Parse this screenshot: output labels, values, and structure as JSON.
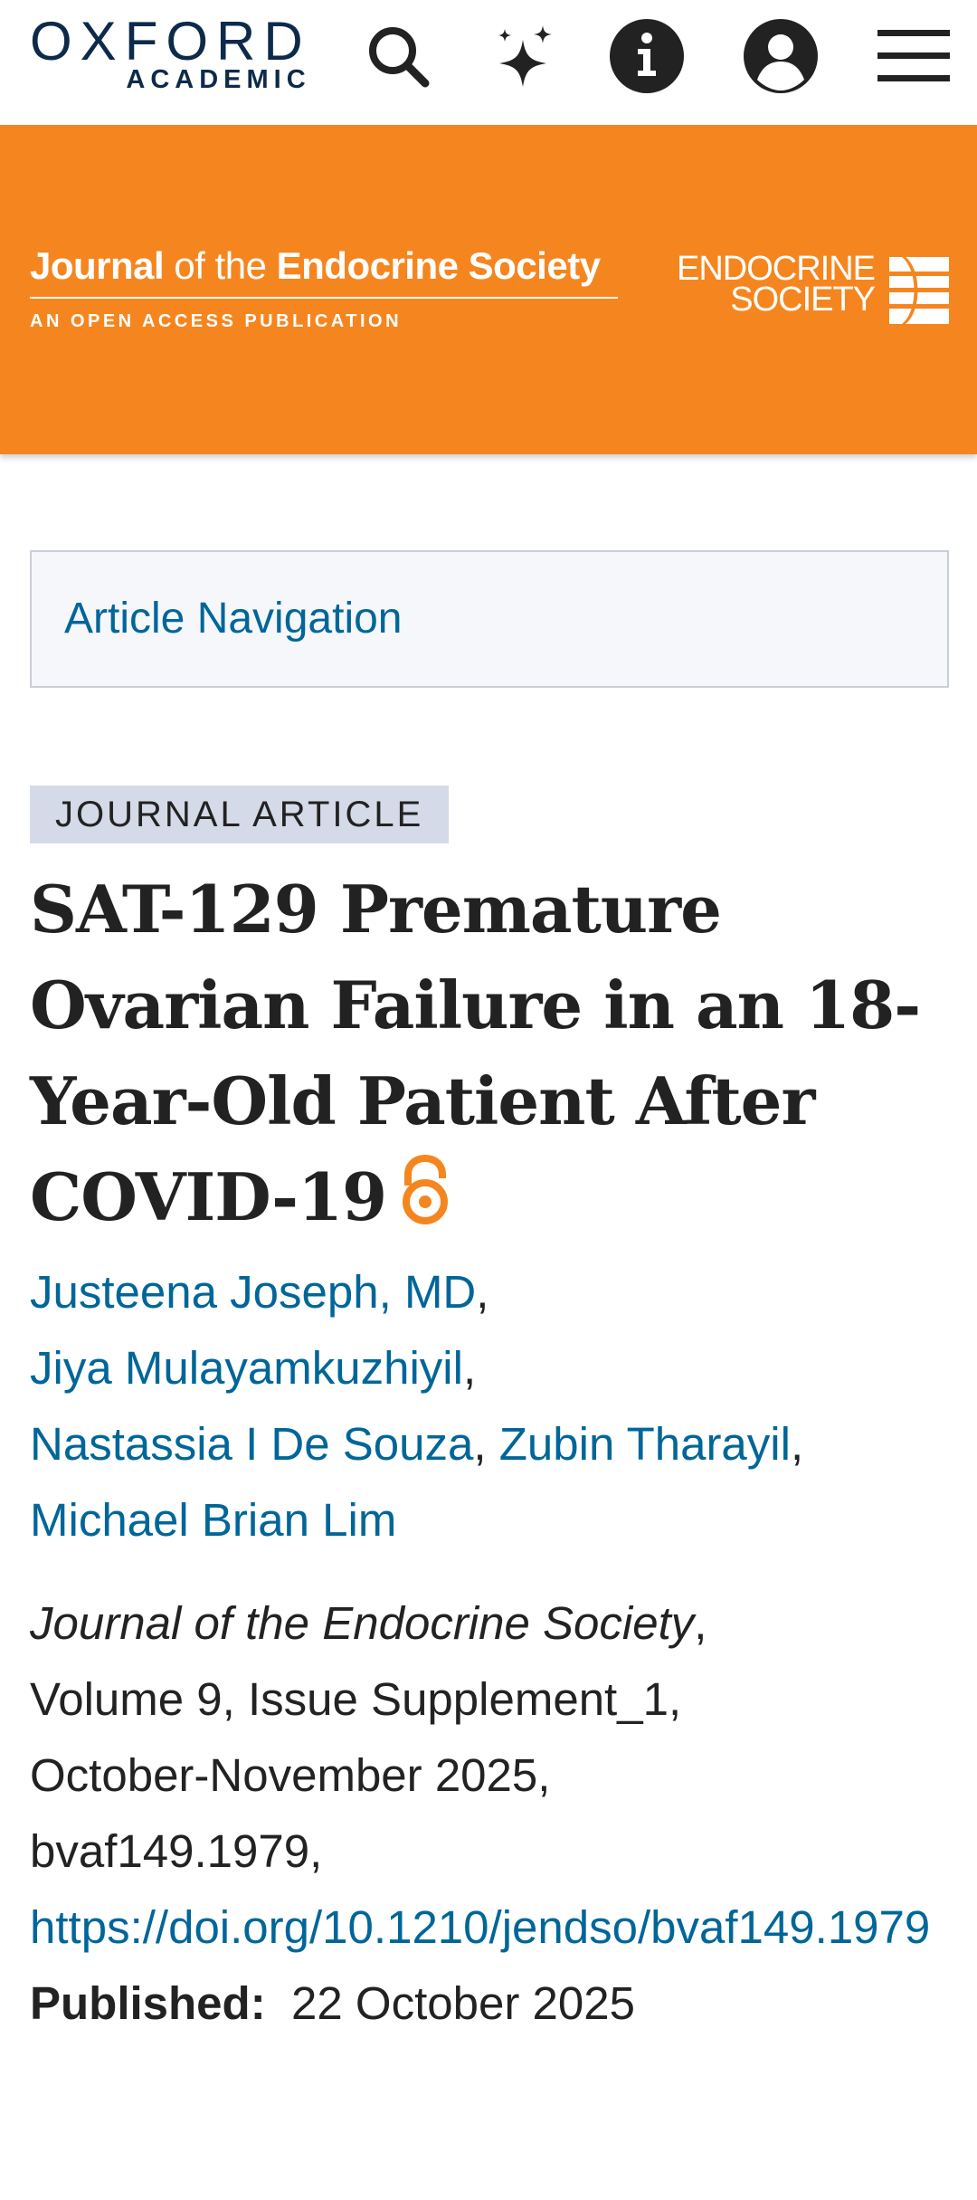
{
  "header": {
    "logo_top": "OXFORD",
    "logo_bottom": "ACADEMIC",
    "icons": [
      "search-icon",
      "sparkle-icon",
      "info-icon",
      "account-icon",
      "menu-icon"
    ]
  },
  "banner": {
    "journal_bold_1": "Journal",
    "journal_light": " of the ",
    "journal_bold_2": "Endocrine Society",
    "subtitle": "AN OPEN ACCESS PUBLICATION",
    "society_line1": "ENDOCRINE",
    "society_line2": "SOCIETY",
    "color": "#f5861f"
  },
  "nav": {
    "label": "Article Navigation"
  },
  "article": {
    "type_tag": "JOURNAL ARTICLE",
    "title": "SAT-129 Premature Ovarian Failure in an 18-Year-Old Patient After COVID-19",
    "authors": [
      "Justeena Joseph, MD",
      "Jiya Mulayamkuzhiyil",
      "Nastassia I De Souza",
      "Zubin Tharayil",
      "Michael Brian Lim"
    ],
    "journal_name": "Journal of the Endocrine Society",
    "volume": "Volume 9, Issue Supplement_1,",
    "date_range": "October-November 2025,",
    "article_id": "bvaf149.1979,",
    "doi": "https://doi.org/10.1210/jendso/bvaf149.1979",
    "published_label": "Published:",
    "published_date": "22 October 2025"
  },
  "colors": {
    "link": "#006699",
    "oa_icon": "#f5861f"
  }
}
